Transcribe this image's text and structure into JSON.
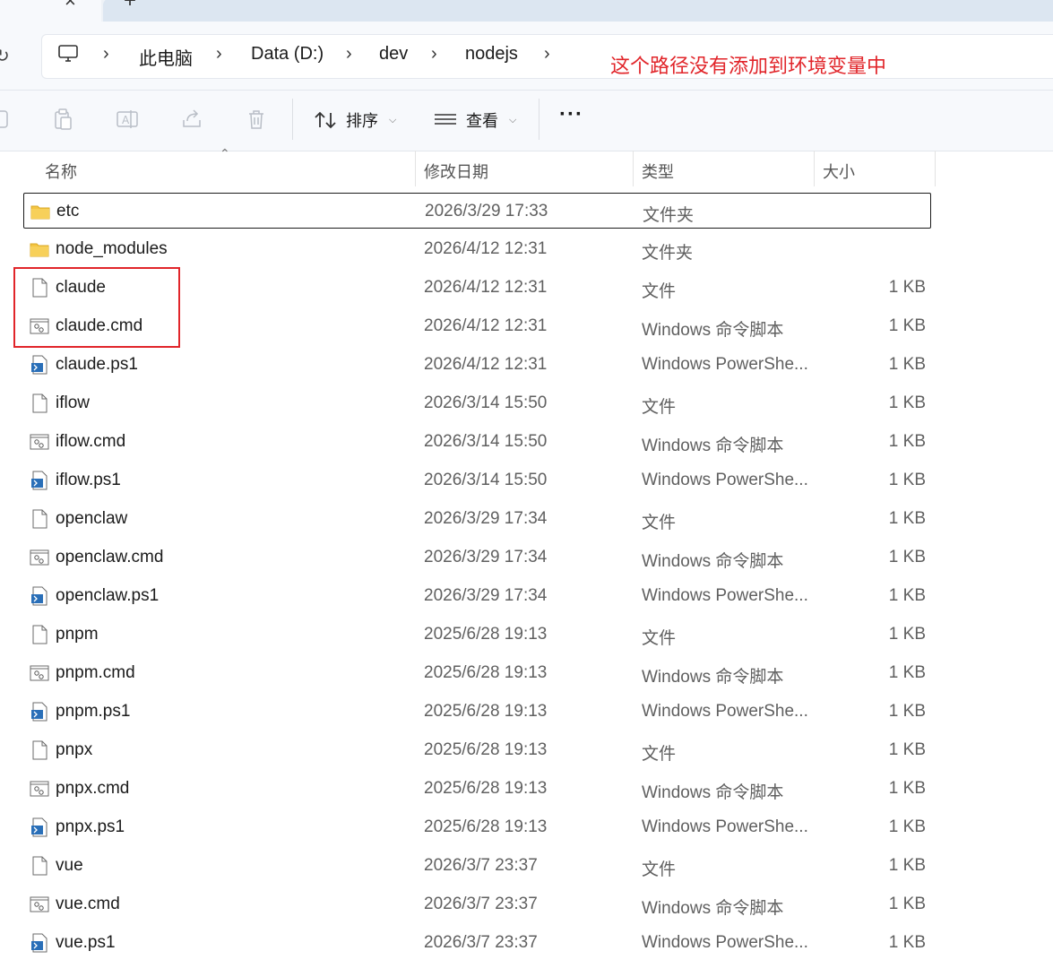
{
  "address": {
    "crumbs": [
      "此电脑",
      "Data (D:)",
      "dev",
      "nodejs"
    ],
    "annotation": "这个路径没有添加到环境变量中"
  },
  "toolbar": {
    "sort_label": "排序",
    "view_label": "查看"
  },
  "columns": {
    "name": "名称",
    "date": "修改日期",
    "type": "类型",
    "size": "大小"
  },
  "files": [
    {
      "name": "etc",
      "date": "2026/3/29 17:33",
      "type": "文件夹",
      "size": "",
      "icon": "folder-icon",
      "selected": true
    },
    {
      "name": "node_modules",
      "date": "2026/4/12 12:31",
      "type": "文件夹",
      "size": "",
      "icon": "folder-icon"
    },
    {
      "name": "claude",
      "date": "2026/4/12 12:31",
      "type": "文件",
      "size": "1 KB",
      "icon": "file-icon"
    },
    {
      "name": "claude.cmd",
      "date": "2026/4/12 12:31",
      "type": "Windows 命令脚本",
      "size": "1 KB",
      "icon": "cmd-script-icon"
    },
    {
      "name": "claude.ps1",
      "date": "2026/4/12 12:31",
      "type": "Windows PowerShe...",
      "size": "1 KB",
      "icon": "powershell-script-icon"
    },
    {
      "name": "iflow",
      "date": "2026/3/14 15:50",
      "type": "文件",
      "size": "1 KB",
      "icon": "file-icon"
    },
    {
      "name": "iflow.cmd",
      "date": "2026/3/14 15:50",
      "type": "Windows 命令脚本",
      "size": "1 KB",
      "icon": "cmd-script-icon"
    },
    {
      "name": "iflow.ps1",
      "date": "2026/3/14 15:50",
      "type": "Windows PowerShe...",
      "size": "1 KB",
      "icon": "powershell-script-icon"
    },
    {
      "name": "openclaw",
      "date": "2026/3/29 17:34",
      "type": "文件",
      "size": "1 KB",
      "icon": "file-icon"
    },
    {
      "name": "openclaw.cmd",
      "date": "2026/3/29 17:34",
      "type": "Windows 命令脚本",
      "size": "1 KB",
      "icon": "cmd-script-icon"
    },
    {
      "name": "openclaw.ps1",
      "date": "2026/3/29 17:34",
      "type": "Windows PowerShe...",
      "size": "1 KB",
      "icon": "powershell-script-icon"
    },
    {
      "name": "pnpm",
      "date": "2025/6/28 19:13",
      "type": "文件",
      "size": "1 KB",
      "icon": "file-icon"
    },
    {
      "name": "pnpm.cmd",
      "date": "2025/6/28 19:13",
      "type": "Windows 命令脚本",
      "size": "1 KB",
      "icon": "cmd-script-icon"
    },
    {
      "name": "pnpm.ps1",
      "date": "2025/6/28 19:13",
      "type": "Windows PowerShe...",
      "size": "1 KB",
      "icon": "powershell-script-icon"
    },
    {
      "name": "pnpx",
      "date": "2025/6/28 19:13",
      "type": "文件",
      "size": "1 KB",
      "icon": "file-icon"
    },
    {
      "name": "pnpx.cmd",
      "date": "2025/6/28 19:13",
      "type": "Windows 命令脚本",
      "size": "1 KB",
      "icon": "cmd-script-icon"
    },
    {
      "name": "pnpx.ps1",
      "date": "2025/6/28 19:13",
      "type": "Windows PowerShe...",
      "size": "1 KB",
      "icon": "powershell-script-icon"
    },
    {
      "name": "vue",
      "date": "2026/3/7 23:37",
      "type": "文件",
      "size": "1 KB",
      "icon": "file-icon"
    },
    {
      "name": "vue.cmd",
      "date": "2026/3/7 23:37",
      "type": "Windows 命令脚本",
      "size": "1 KB",
      "icon": "cmd-script-icon"
    },
    {
      "name": "vue.ps1",
      "date": "2026/3/7 23:37",
      "type": "Windows PowerShe...",
      "size": "1 KB",
      "icon": "powershell-script-icon"
    }
  ],
  "colors": {
    "annotation": "#e1252a",
    "folder": "#f4c542",
    "powershell": "#2a6fb8"
  }
}
